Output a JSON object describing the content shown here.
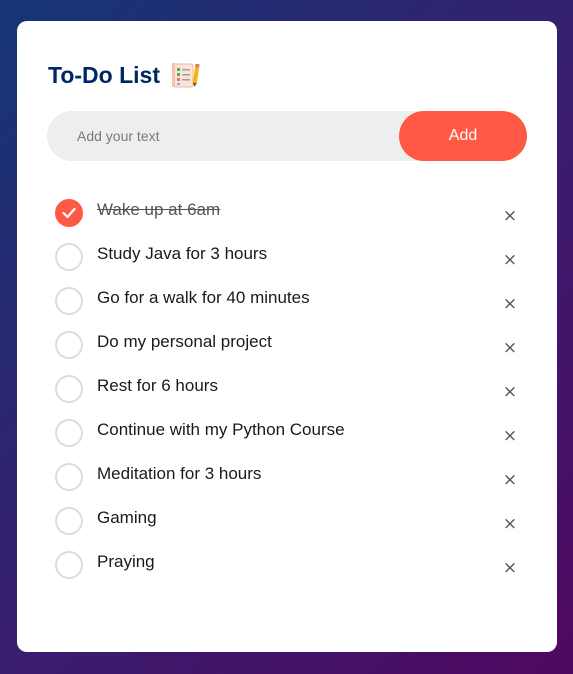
{
  "app": {
    "title": "To-Do List",
    "title_icon": "notepad-checklist-icon"
  },
  "input": {
    "placeholder": "Add your text",
    "value": ""
  },
  "add_button": {
    "label": "Add"
  },
  "colors": {
    "accent": "#ff5945",
    "title": "#002765",
    "input_bg": "#edeef0",
    "background_gradient": [
      "#153677",
      "#4e085f"
    ]
  },
  "tasks": [
    {
      "text": "Wake up at 6am",
      "checked": true,
      "delete_label": "×"
    },
    {
      "text": "Study Java for 3 hours",
      "checked": false,
      "delete_label": "×"
    },
    {
      "text": "Go for a walk for 40 minutes",
      "checked": false,
      "delete_label": "×"
    },
    {
      "text": "Do my personal project",
      "checked": false,
      "delete_label": "×"
    },
    {
      "text": "Rest for 6 hours",
      "checked": false,
      "delete_label": "×"
    },
    {
      "text": "Continue with my Python Course",
      "checked": false,
      "delete_label": "×"
    },
    {
      "text": "Meditation for 3 hours",
      "checked": false,
      "delete_label": "×"
    },
    {
      "text": "Gaming",
      "checked": false,
      "delete_label": "×"
    },
    {
      "text": "Praying",
      "checked": false,
      "delete_label": "×"
    }
  ]
}
